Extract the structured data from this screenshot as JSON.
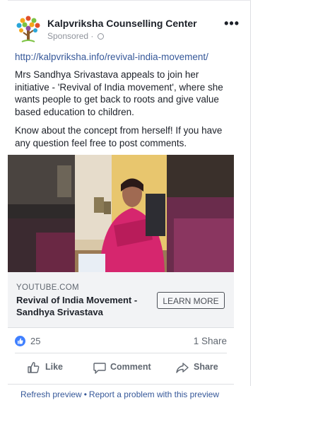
{
  "post": {
    "page_name": "Kalpvriksha Counselling Center",
    "sponsored_label": "Sponsored",
    "sponsored_sep": "·",
    "more_icon": "ellipsis-icon",
    "more_glyph": "•••",
    "link": "http://kalpvriksha.info/revival-india-movement/",
    "paragraph_1": "Mrs Sandhya Srivastava appeals to join her initiative - 'Revival of India movement', where she wants people to get back to roots and give value based education to children.",
    "paragraph_2": "Know about the concept from herself! If you have any question feel free to post comments."
  },
  "preview": {
    "source": "YOUTUBE.COM",
    "title": "Revival of India Movement - Sandhya Srivastava",
    "cta": "LEARN MORE"
  },
  "stats": {
    "likes": "25",
    "shares": "1 Share"
  },
  "actions": {
    "like": "Like",
    "comment": "Comment",
    "share": "Share"
  },
  "footer": {
    "refresh": "Refresh preview",
    "separator": "•",
    "report": "Report a problem with this preview"
  },
  "colors": {
    "link": "#365899",
    "like_badge": "#4080ff",
    "saree_pink": "#d6266e",
    "wall_yellow": "#e8c66e"
  }
}
